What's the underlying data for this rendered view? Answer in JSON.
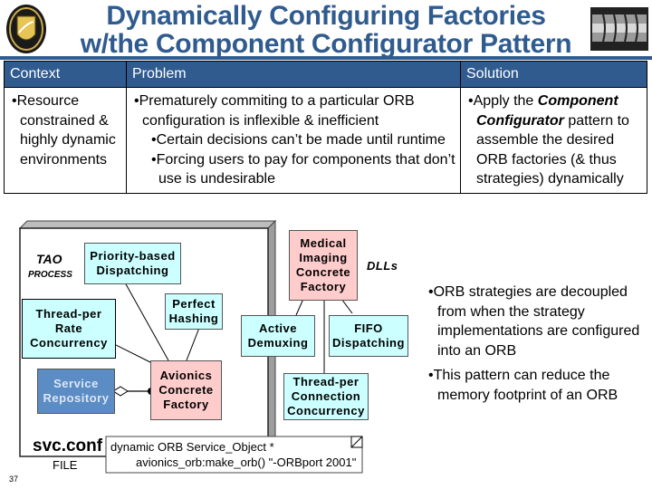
{
  "title": {
    "line1": "Dynamically Configuring Factories",
    "line2": "w/the Component Configurator Pattern"
  },
  "logos": {
    "left": "university-crest-logo",
    "right": "isis-institute-logo"
  },
  "colors": {
    "accent": "#2f5b8f",
    "cyan_box": "#ccffff",
    "pink_box": "#ffcccc",
    "blue_box": "#5b8cc4"
  },
  "table": {
    "headers": [
      "Context",
      "Problem",
      "Solution"
    ],
    "context": "Resource constrained & highly dynamic environments",
    "problem": {
      "main": "Prematurely commiting to a particular ORB configuration is inflexible & inefficient",
      "sub": [
        "Certain decisions can’t be made until runtime",
        "Forcing users to pay for components that don’t use is undesirable"
      ]
    },
    "solution": {
      "prefix": "Apply the ",
      "emphasis": "Component Configurator",
      "suffix": " pattern to assemble the desired ORB factories (& thus strategies) dynamically"
    }
  },
  "diagram": {
    "process_label": "TAO",
    "process_sublabel": "PROCESS",
    "dlls_label": "DLLs",
    "boxes": {
      "priority": "Priority-based Dispatching",
      "perfect": "Perfect Hashing",
      "thread_rate": "Thread-per Rate Concurrency",
      "service_repo": "Service Repository",
      "avionics": "Avionics Concrete Factory",
      "medical": "Medical Imaging Concrete Factory",
      "active": "Active Demuxing",
      "fifo": "FIFO Dispatching",
      "thread_conn": "Thread-per Connection Concurrency"
    },
    "svc_conf_label": "svc.conf",
    "svc_conf_sublabel": "FILE",
    "svc_conf_line1": "dynamic ORB Service_Object *",
    "svc_conf_line2": "avionics_orb:make_orb() \"-ORBport 2001\""
  },
  "right_bullets": [
    "ORB strategies are decoupled from when the strategy implementations are configured into an ORB",
    "This pattern can reduce the memory footprint of an ORB"
  ],
  "page_number": "37"
}
